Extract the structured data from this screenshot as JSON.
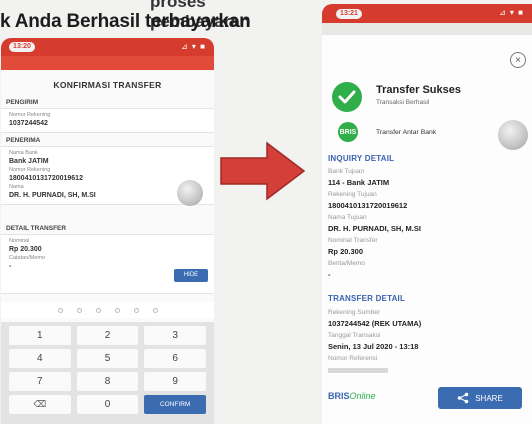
{
  "heading": {
    "partial_text": "proses pembayaran",
    "main_text": "k Anda Berhasil terbayarkan"
  },
  "left_phone": {
    "status_time": "13:20",
    "status_icons": "⊿ ▾ ■",
    "title": "KONFIRMASI TRANSFER",
    "pengirim": {
      "header": "PENGIRIM",
      "label": "Nomor Rekening",
      "value": "1037244542"
    },
    "penerima": {
      "header": "PENERIMA",
      "bank_label": "Nama Bank",
      "bank_value": "Bank JATIM",
      "account_label": "Nomor Rekening",
      "account_value": "1800410131720019612",
      "name_label": "Nama",
      "name_value": "DR. H. PURNADI, SH, M.SI"
    },
    "detail": {
      "header": "DETAIL TRANSFER",
      "nominal_label": "Nominal",
      "nominal_value": "Rp 20.300",
      "memo_label": "Catatan/Memo",
      "memo_value": "-",
      "hide_label": "HIDE"
    },
    "keys": [
      "1",
      "2",
      "3",
      "4",
      "5",
      "6",
      "7",
      "8",
      "9",
      "⌫",
      "0",
      "CONFIRM"
    ]
  },
  "right_phone": {
    "status_time": "13:21",
    "status_icons": "⊿ ▾ ■",
    "close_symbol": "×",
    "success_title": "Transfer Sukses",
    "success_subtitle": "Transaksi Berhasil",
    "bank_badge": "BRIS",
    "transfer_type": "Transfer Antar Bank",
    "inquiry": {
      "title": "INQUIRY DETAIL",
      "bank_label": "Bank Tujuan",
      "bank_value": "114 - Bank JATIM",
      "account_label": "Rekening Tujuan",
      "account_value": "1800410131720019612",
      "name_label": "Nama Tujuan",
      "name_value": "DR. H. PURNADI, SH, M.SI",
      "nominal_label": "Nominal Transfer",
      "nominal_value": "Rp 20.300",
      "memo_label": "Berita/Memo",
      "memo_value": "-"
    },
    "transfer": {
      "title": "TRANSFER DETAIL",
      "source_label": "Rekening Sumber",
      "source_value": "1037244542 (REK UTAMA)",
      "date_label": "Tanggal Transaksi",
      "date_value": "Senin, 13 Jul 2020 - 13:18",
      "ref_label": "Nomor Referensi"
    },
    "brand_bris": "BRIS",
    "brand_online": "Online",
    "share_label": "SHARE"
  },
  "colors": {
    "status_red": "#d63c2d",
    "accent_blue": "#3b6bb0",
    "success_green": "#2fae4a",
    "arrow_red": "#d43f3a"
  }
}
